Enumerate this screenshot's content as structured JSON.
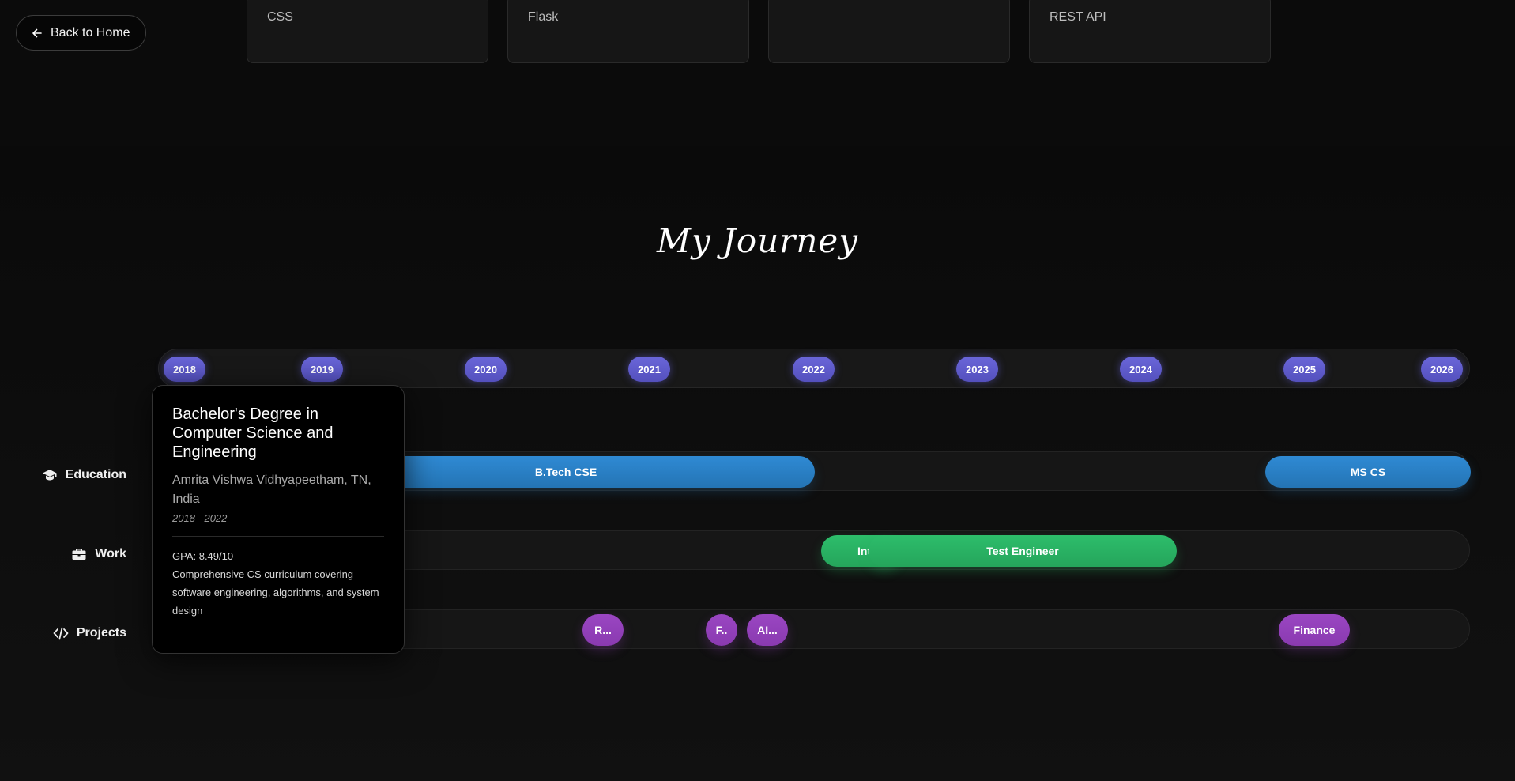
{
  "nav": {
    "back_label": "Back to Home"
  },
  "skills": [
    {
      "label": "CSS"
    },
    {
      "label": "Flask"
    },
    {
      "label": ""
    },
    {
      "label": "REST API"
    }
  ],
  "journey": {
    "title": "My Journey",
    "years": [
      "2018",
      "2019",
      "2020",
      "2021",
      "2022",
      "2023",
      "2024",
      "2025",
      "2026"
    ],
    "tracks": {
      "education": {
        "label": "Education",
        "icon": "graduation-cap-icon",
        "bars": [
          {
            "label": "B.Tech CSE"
          },
          {
            "label": "MS CS"
          }
        ]
      },
      "work": {
        "label": "Work",
        "icon": "briefcase-icon",
        "bars": [
          {
            "label": "Int"
          },
          {
            "label": "Test Engineer"
          }
        ]
      },
      "projects": {
        "label": "Projects",
        "icon": "code-icon",
        "bars": [
          {
            "label": "R..."
          },
          {
            "label": "F.."
          },
          {
            "label": "AI..."
          },
          {
            "label": "Finance"
          }
        ]
      }
    },
    "tooltip": {
      "title": "Bachelor's Degree in Computer Science and Engineering",
      "institution": "Amrita Vishwa Vidhyapeetham, TN, India",
      "period": "2018 - 2022",
      "gpa": "GPA: 8.49/10",
      "description": "Comprehensive CS curriculum covering software engineering, algorithms, and system design"
    }
  },
  "colors": {
    "year_badge": "#5f5bcc",
    "education": "#2a7fc6",
    "work": "#29b062",
    "projects": "#923fb8",
    "background": "#0b0b0b"
  }
}
